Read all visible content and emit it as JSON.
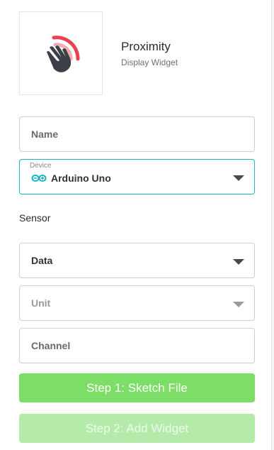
{
  "widget": {
    "title": "Proximity",
    "subtitle": "Display Widget",
    "icon": "waving-hand-proximity-icon"
  },
  "form": {
    "name_placeholder": "Name",
    "device": {
      "label": "Device",
      "value": "Arduino Uno",
      "icon": "arduino-infinity-icon"
    },
    "sensor_label": "Sensor",
    "data_select": "Data",
    "unit_select": "Unit",
    "channel_placeholder": "Channel"
  },
  "buttons": {
    "step1": "Step 1: Sketch File",
    "step2": "Step 2: Add Widget"
  },
  "colors": {
    "accent": "#19b3c5",
    "primary_button": "#7cde67",
    "secondary_button": "#b4ebab",
    "icon_red": "#e8424f",
    "icon_dark": "#3c3f46"
  }
}
